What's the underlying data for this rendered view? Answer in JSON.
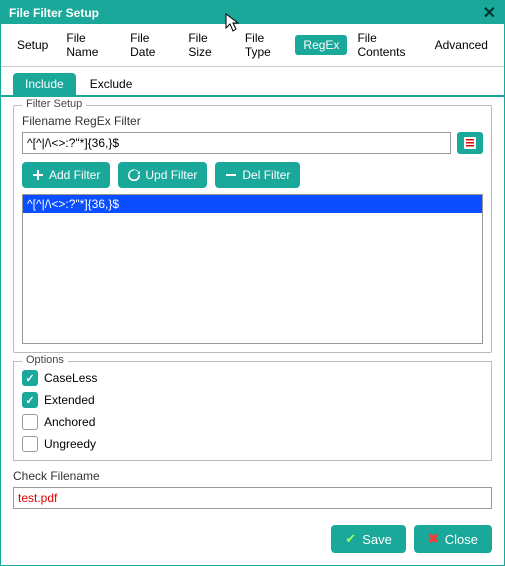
{
  "window": {
    "title": "File Filter Setup"
  },
  "menu": {
    "items": [
      {
        "label": "Setup",
        "active": false
      },
      {
        "label": "File Name",
        "active": false
      },
      {
        "label": "File Date",
        "active": false
      },
      {
        "label": "File Size",
        "active": false
      },
      {
        "label": "File Type",
        "active": false
      },
      {
        "label": "RegEx",
        "active": true
      },
      {
        "label": "File Contents",
        "active": false
      },
      {
        "label": "Advanced",
        "active": false
      }
    ]
  },
  "tabs": {
    "items": [
      {
        "label": "Include",
        "active": true
      },
      {
        "label": "Exclude",
        "active": false
      }
    ]
  },
  "filter_setup": {
    "legend": "Filter Setup",
    "filename_label": "Filename RegEx Filter",
    "filter_value": "^[^|/\\<>:?\"*]{36,}$",
    "add_label": "Add Filter",
    "upd_label": "Upd Filter",
    "del_label": "Del Filter",
    "list_items": [
      {
        "text": "^[^|/\\<>:?\"*]{36,}$",
        "selected": true
      }
    ]
  },
  "options": {
    "legend": "Options",
    "items": [
      {
        "label": "CaseLess",
        "checked": true
      },
      {
        "label": "Extended",
        "checked": true
      },
      {
        "label": "Anchored",
        "checked": false
      },
      {
        "label": "Ungreedy",
        "checked": false
      }
    ]
  },
  "check_filename": {
    "label": "Check Filename",
    "value": "test.pdf"
  },
  "footer": {
    "save_label": "Save",
    "close_label": "Close"
  }
}
